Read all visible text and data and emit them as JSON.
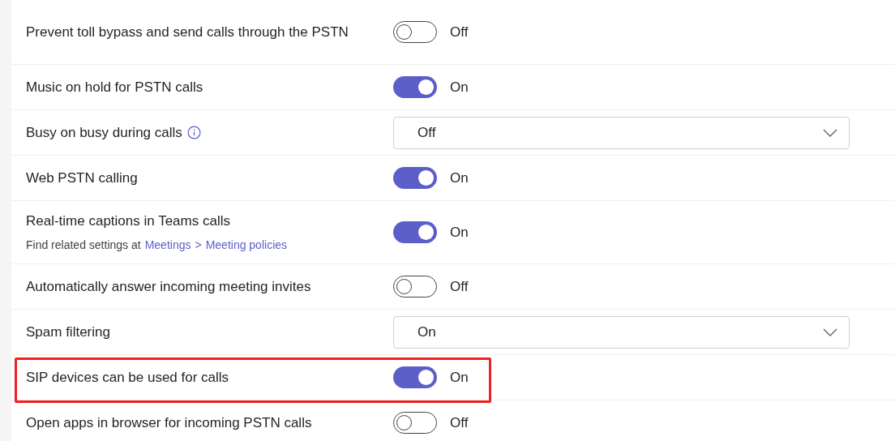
{
  "settings": [
    {
      "label": "Prevent toll bypass and send calls through the PSTN",
      "kind": "toggle",
      "state_text": "Off",
      "value_on": false,
      "highlighted": false
    },
    {
      "label": "Music on hold for PSTN calls",
      "kind": "toggle",
      "value_on": true,
      "state_text": "On",
      "highlighted": false
    },
    {
      "label": "Busy on busy during calls",
      "kind": "dropdown",
      "info": true,
      "value": "Off",
      "highlighted": false
    },
    {
      "label": "Web PSTN calling",
      "kind": "toggle",
      "value_on": true,
      "state_text": "On",
      "highlighted": false
    },
    {
      "label": "Real-time captions in Teams calls",
      "kind": "toggle",
      "value_on": true,
      "state_text": "On",
      "highlighted": false,
      "note": {
        "text": "Find related settings at",
        "links": [
          "Meetings",
          "Meeting policies"
        ],
        "separator": ">"
      }
    },
    {
      "label": "Automatically answer incoming meeting invites",
      "kind": "toggle",
      "value_on": false,
      "state_text": "Off",
      "highlighted": false
    },
    {
      "label": "Spam filtering",
      "kind": "dropdown",
      "value": "On",
      "highlighted": false
    },
    {
      "label": "SIP devices can be used for calls",
      "kind": "toggle",
      "value_on": true,
      "state_text": "On",
      "highlighted": true
    },
    {
      "label": "Open apps in browser for incoming PSTN calls",
      "kind": "toggle",
      "value_on": false,
      "state_text": "Off",
      "highlighted": false
    }
  ]
}
